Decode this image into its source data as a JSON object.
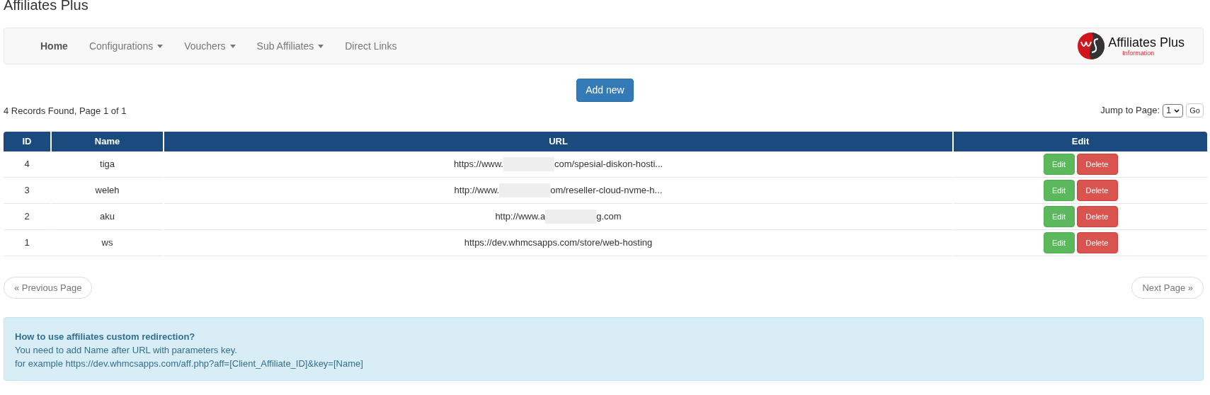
{
  "page_title": "Affiliates Plus",
  "nav": {
    "items": [
      {
        "label": "Home",
        "selected": true,
        "dropdown": false
      },
      {
        "label": "Configurations",
        "selected": false,
        "dropdown": true
      },
      {
        "label": "Vouchers",
        "selected": false,
        "dropdown": true
      },
      {
        "label": "Sub Affiliates",
        "selected": false,
        "dropdown": true
      },
      {
        "label": "Direct Links",
        "selected": false,
        "dropdown": false
      }
    ],
    "brand": {
      "name": "Affiliates Plus",
      "subtitle": "Information"
    }
  },
  "add_button": "Add new",
  "records_info": "4 Records Found, Page 1 of 1",
  "jump": {
    "label": "Jump to Page:",
    "value": "1",
    "go": "Go"
  },
  "table": {
    "columns": [
      "ID",
      "Name",
      "URL",
      "Edit"
    ],
    "rows": [
      {
        "id": "4",
        "name": "tiga",
        "url_start": "https://www.",
        "redacted": true,
        "url_end": "com/spesial-diskon-hosti...",
        "edit": "Edit",
        "delete": "Delete"
      },
      {
        "id": "3",
        "name": "weleh",
        "url_start": "http://www.",
        "redacted": true,
        "url_end": "om/reseller-cloud-nvme-h...",
        "edit": "Edit",
        "delete": "Delete"
      },
      {
        "id": "2",
        "name": "aku",
        "url_start": "http://www.a",
        "redacted": true,
        "url_end": "g.com",
        "edit": "Edit",
        "delete": "Delete"
      },
      {
        "id": "1",
        "name": "ws",
        "url_start": "https://dev.whmcsapps.com/store/web-hosting",
        "redacted": false,
        "edit": "Edit",
        "delete": "Delete"
      }
    ]
  },
  "pagination": {
    "previous": "« Previous Page",
    "next": "Next Page »"
  },
  "info": {
    "title": "How to use affiliates custom redirection?",
    "lines": [
      "You need to add Name after URL with parameters key.",
      "for example https://dev.whmcsapps.com/aff.php?aff=[Client_Affiliate_ID]&key=[Name]"
    ]
  }
}
